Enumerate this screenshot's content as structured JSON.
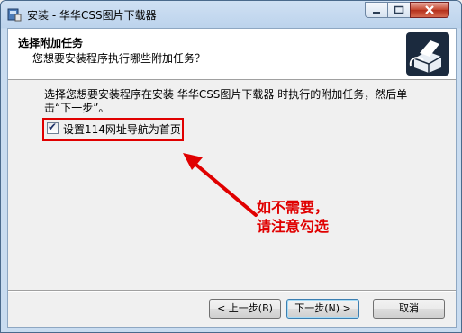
{
  "window": {
    "title": "安装 - 华华CSS图片下载器"
  },
  "header": {
    "title": "选择附加任务",
    "subtitle": "您想要安装程序执行哪些附加任务？"
  },
  "main": {
    "instructions": "选择您想要安装程序在安装 华华CSS图片下载器 时执行的附加任务，然后单击“下一步”。",
    "task": {
      "label": "设置114网址导航为首页",
      "checked": true
    }
  },
  "annotation": {
    "line1": "如不需要，",
    "line2": "请注意勾选"
  },
  "buttons": {
    "back": "< 上一步(B)",
    "next": "下一步(N) >",
    "cancel": "取消"
  },
  "colors": {
    "annotation": "#e00000",
    "titlebar": "#bcd3ec"
  }
}
